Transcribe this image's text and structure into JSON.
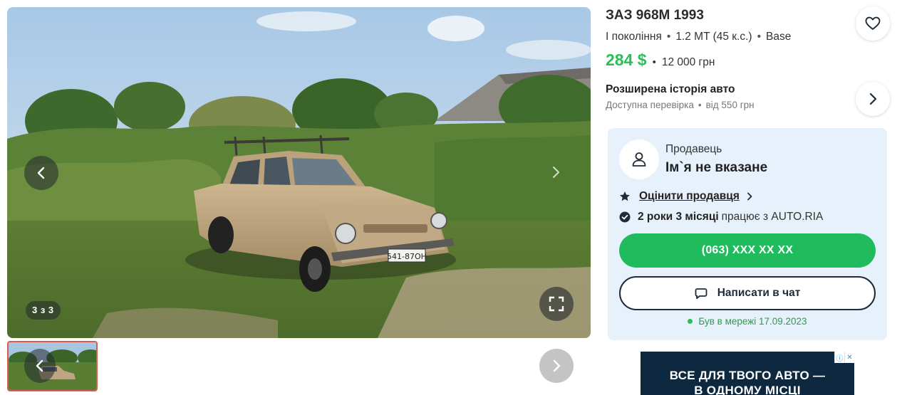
{
  "gallery": {
    "counter": "3 з 3",
    "prev_label": "previous-photo",
    "next_label": "next-photo"
  },
  "listing": {
    "title": "ЗАЗ 968М 1993",
    "generation": "I покоління",
    "engine": "1.2 MT (45 к.с.)",
    "trim": "Base",
    "price_usd": "284 $",
    "price_uah": "12 000 грн"
  },
  "history": {
    "title": "Розширена історія авто",
    "subtitle_left": "Доступна перевірка",
    "subtitle_right": "від 550 грн"
  },
  "seller": {
    "label": "Продавець",
    "name": "Ім`я не вказане",
    "rate_label": "Оцінити продавця",
    "experience_bold": "2 роки 3 місяці",
    "experience_rest": "працює з AUTO.RIA",
    "phone": "(063) XXX XX XX",
    "chat_label": "Написати в чат",
    "online_status": "Був в мережі 17.09.2023"
  },
  "ad": {
    "line1": "ВСЕ ДЛЯ ТВОГО АВТО —",
    "line2": "В ОДНОМУ МІСЦІ"
  },
  "colors": {
    "price": "#2ebd59",
    "phone_button": "#20bb5c",
    "seller_card_bg": "#e7f1fb",
    "thumb_border": "#db5c4c"
  },
  "icons": {
    "favorite": "heart-icon",
    "history": "chevron-right-icon",
    "avatar": "user-icon",
    "rate": "star-icon",
    "experience": "check-badge-icon",
    "chat": "chat-bubble-icon",
    "fullscreen": "expand-icon"
  }
}
